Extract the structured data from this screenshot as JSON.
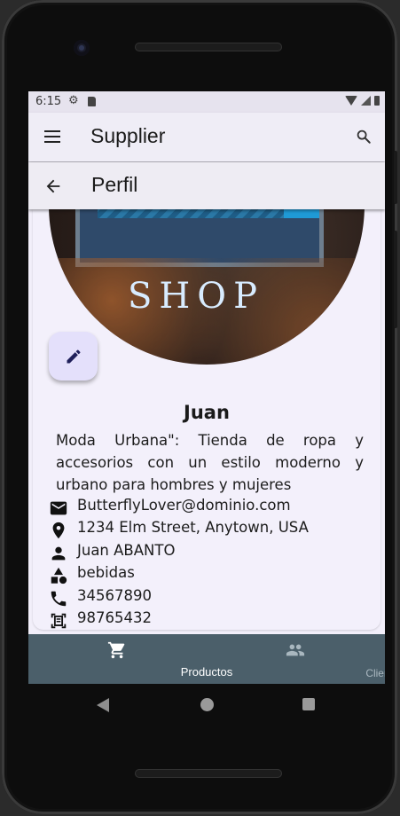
{
  "status_bar": {
    "time": "6:15"
  },
  "app_bar": {
    "title": "Supplier"
  },
  "sub_bar": {
    "title": "Perfil"
  },
  "photo": {
    "sign_text": "SHOP"
  },
  "profile": {
    "name": "Juan",
    "description": "Moda Urbana\": Tienda de ropa y accesorios con un estilo moderno y urbano para hombres y mujeres",
    "fields": [
      {
        "icon": "email-icon",
        "value": "ButterflyLover@dominio.com"
      },
      {
        "icon": "location-pin-icon",
        "value": "1234 Elm Street, Anytown, USA"
      },
      {
        "icon": "person-icon",
        "value": "Juan ABANTO"
      },
      {
        "icon": "category-shapes-icon",
        "value": "bebidas"
      },
      {
        "icon": "phone-icon",
        "value": "34567890"
      },
      {
        "icon": "document-scanner-icon",
        "value": "98765432"
      }
    ]
  },
  "bottom_nav": {
    "items": [
      {
        "label": "Productos",
        "icon": "cart-icon",
        "active": true
      },
      {
        "label": "Clientes",
        "icon": "people-icon",
        "active": false
      }
    ]
  },
  "colors": {
    "bottom_nav_bg": "#4b5f6a",
    "screen_bg": "#f2effa",
    "fab_bg": "#e4e0fb",
    "accent": "#3b3f9e"
  }
}
